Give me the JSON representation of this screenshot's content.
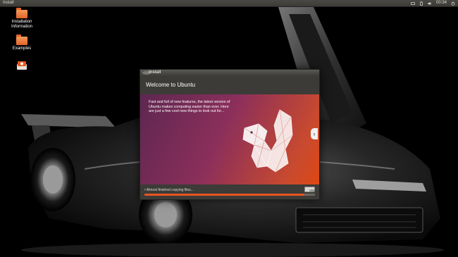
{
  "top_panel": {
    "title": "Install",
    "clock": "00:34",
    "icons": [
      "keyboard-icon",
      "battery-icon",
      "volume-icon",
      "power-icon"
    ]
  },
  "desktop": {
    "icons": [
      {
        "label": "Installation Information",
        "icon": "folder-icon"
      },
      {
        "label": "Examples",
        "icon": "folder-icon"
      },
      {
        "label": "",
        "icon": "ubuntu-installer-icon"
      }
    ]
  },
  "install_window": {
    "title": "Install",
    "header": "Welcome to Ubuntu",
    "slide_text": "Fast and full of new features, the latest version of Ubuntu makes computing easier than ever. Here are just a few cool new things to look out for...",
    "next_icon": "chevron-right-icon",
    "status_text": "• Almost finished copying files...",
    "skip_label": "Skip",
    "progress": 0.94
  },
  "colors": {
    "accent": "#e95420",
    "panel": "#3c3b37",
    "slide_start": "#5e2750",
    "slide_end": "#dd4814"
  }
}
